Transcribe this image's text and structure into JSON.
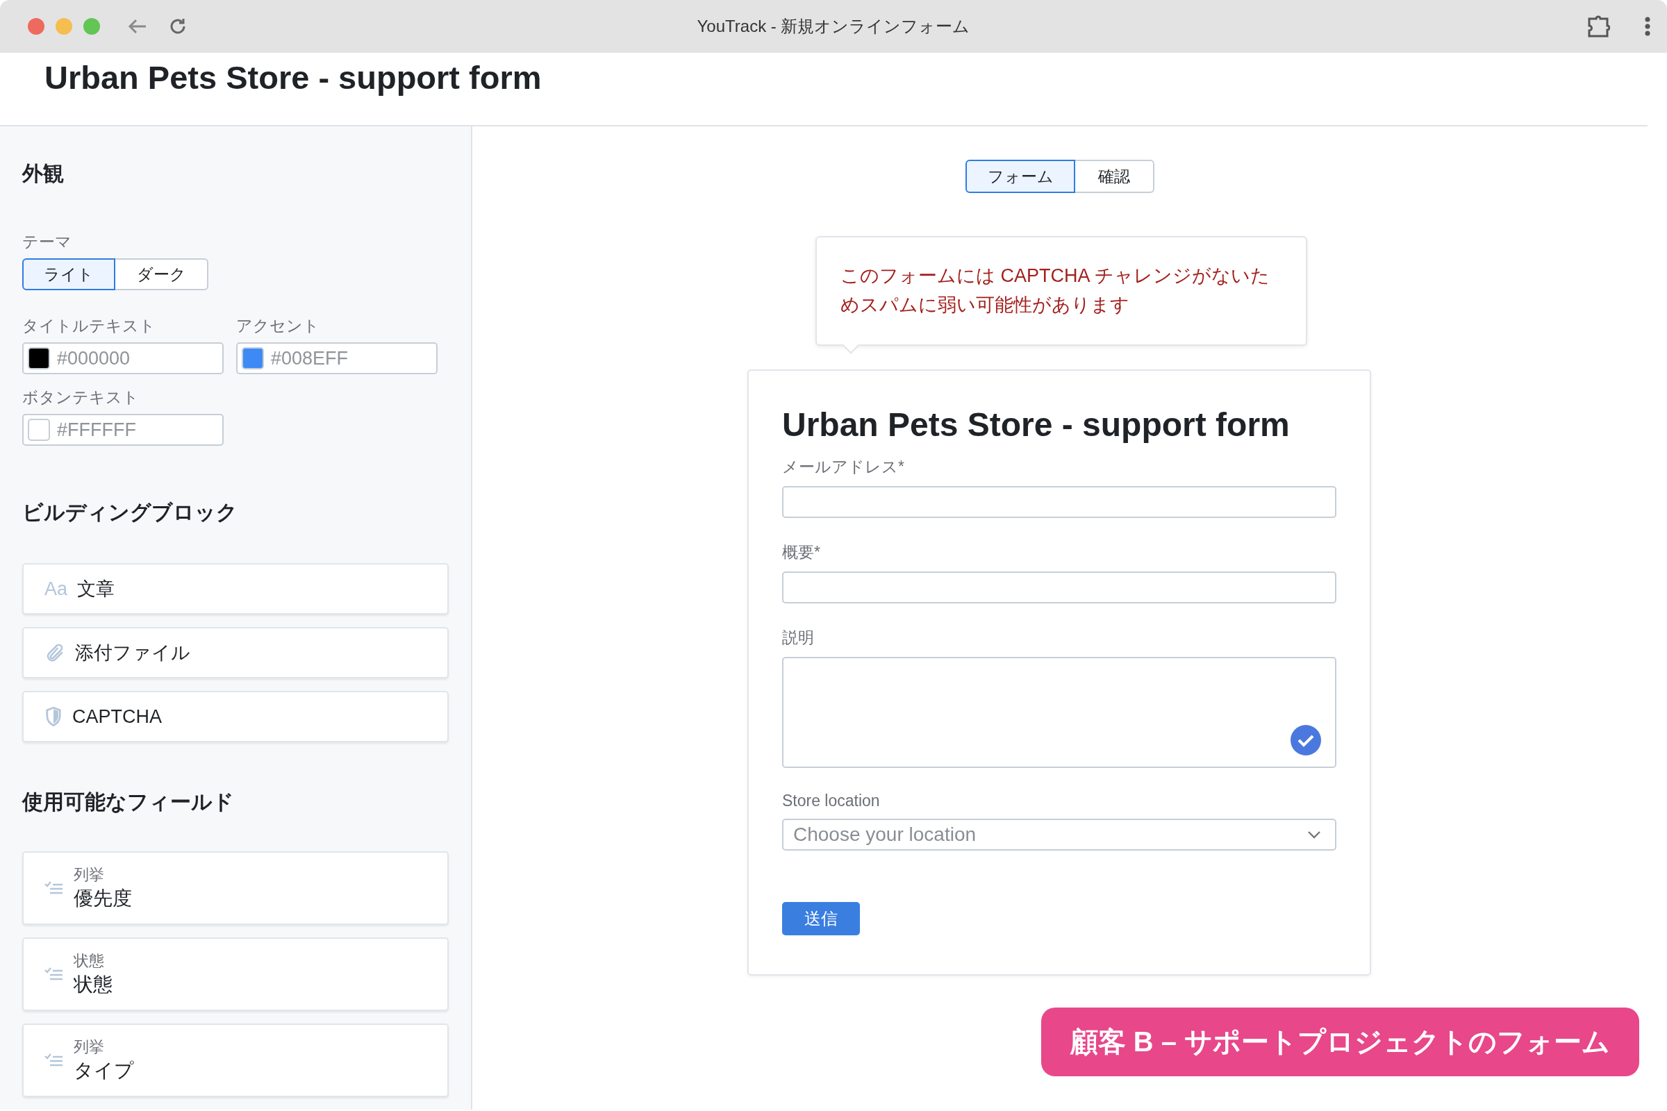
{
  "window": {
    "title": "YouTrack - 新規オンラインフォーム"
  },
  "page_title": "Urban Pets Store - support form",
  "sidebar": {
    "appearance": {
      "heading": "外観",
      "theme_label": "テーマ",
      "themes": [
        {
          "label": "ライト",
          "selected": true
        },
        {
          "label": "ダーク",
          "selected": false
        }
      ],
      "colors": [
        {
          "label": "タイトルテキスト",
          "value": "#000000",
          "color": "#000000"
        },
        {
          "label": "アクセント",
          "value": "#008EFF",
          "color": "#3d8af7"
        },
        {
          "label": "ボタンテキスト",
          "value": "#FFFFFF",
          "color": "#ffffff"
        }
      ]
    },
    "blocks": {
      "heading": "ビルディングブロック",
      "items": [
        {
          "kind": "text",
          "icon": "Aa",
          "label": "文章"
        },
        {
          "kind": "attachment",
          "label": "添付ファイル"
        },
        {
          "kind": "captcha",
          "label": "CAPTCHA"
        }
      ]
    },
    "fields": {
      "heading": "使用可能なフィールド",
      "items": [
        {
          "type": "列挙",
          "name": "優先度"
        },
        {
          "type": "状態",
          "name": "状態"
        },
        {
          "type": "列挙",
          "name": "タイプ"
        }
      ]
    }
  },
  "tabs": [
    {
      "label": "フォーム",
      "selected": true
    },
    {
      "label": "確認",
      "selected": false
    }
  ],
  "warning": "このフォームには CAPTCHA チャレンジがないためスパムに弱い可能性があります",
  "form": {
    "title": "Urban Pets Store - support form",
    "fields": [
      {
        "kind": "input",
        "label": "メールアドレス*"
      },
      {
        "kind": "input",
        "label": "概要*"
      },
      {
        "kind": "textarea",
        "label": "説明"
      },
      {
        "kind": "select",
        "label": "Store location",
        "placeholder": "Choose your location"
      }
    ],
    "submit": "送信"
  },
  "banner": "顧客 B – サポートプロジェクトのフォーム"
}
